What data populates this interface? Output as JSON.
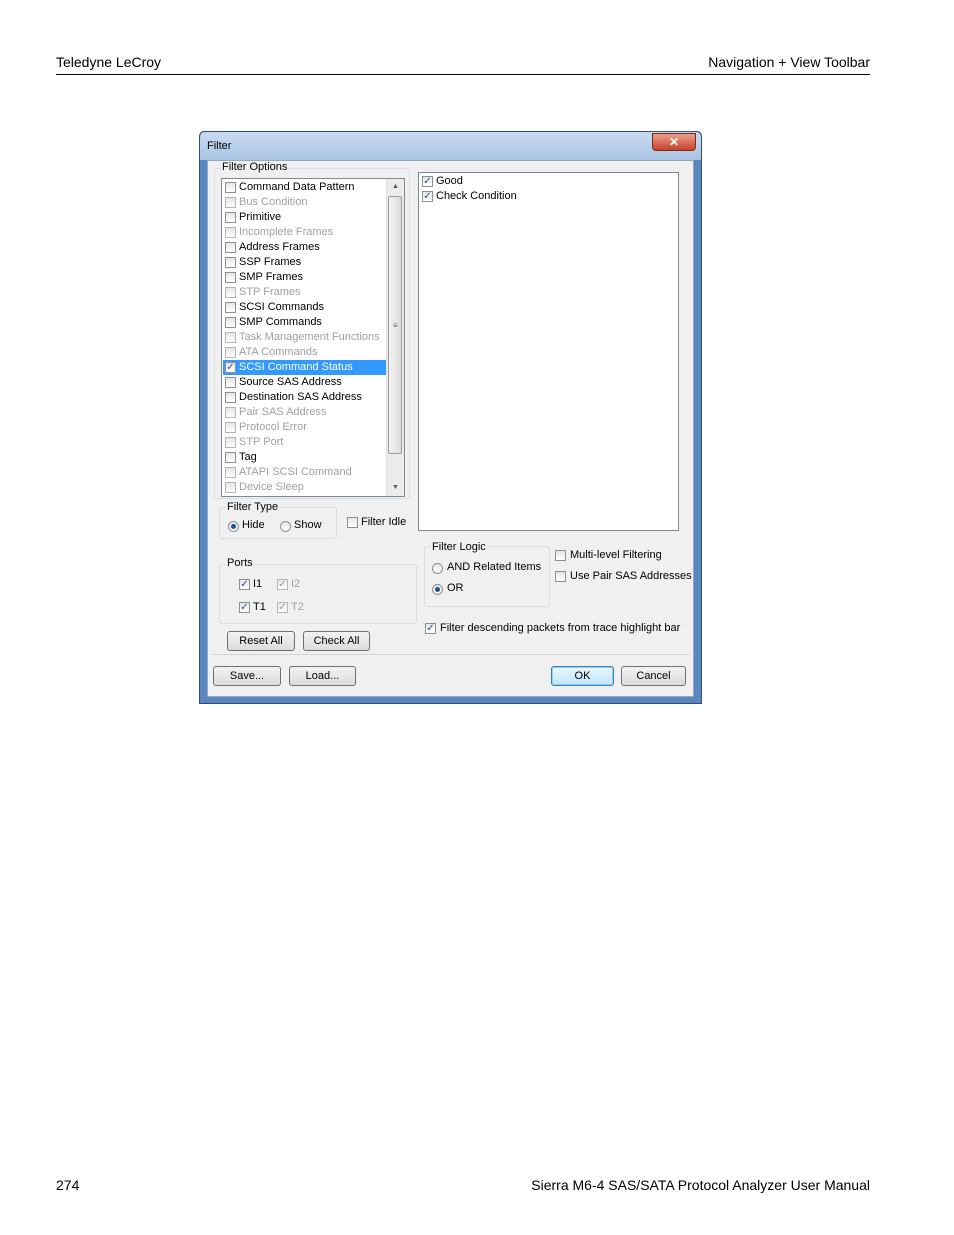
{
  "page": {
    "header_left": "Teledyne LeCroy",
    "header_right": "Navigation + View Toolbar",
    "footer_left": "274",
    "footer_right": "Sierra M6-4 SAS/SATA Protocol Analyzer User Manual"
  },
  "dialog": {
    "title": "Filter",
    "close_glyph": "✕",
    "filter_options": {
      "label": "Filter Options",
      "items": [
        {
          "label": "Command Data Pattern",
          "checked": false,
          "enabled": true,
          "selected": false
        },
        {
          "label": "Bus Condition",
          "checked": false,
          "enabled": false,
          "selected": false
        },
        {
          "label": "Primitive",
          "checked": false,
          "enabled": true,
          "selected": false
        },
        {
          "label": "Incomplete Frames",
          "checked": false,
          "enabled": false,
          "selected": false
        },
        {
          "label": "Address Frames",
          "checked": false,
          "enabled": true,
          "selected": false
        },
        {
          "label": "SSP Frames",
          "checked": false,
          "enabled": true,
          "selected": false
        },
        {
          "label": "SMP Frames",
          "checked": false,
          "enabled": true,
          "selected": false
        },
        {
          "label": "STP Frames",
          "checked": false,
          "enabled": false,
          "selected": false
        },
        {
          "label": "SCSI Commands",
          "checked": false,
          "enabled": true,
          "selected": false
        },
        {
          "label": "SMP Commands",
          "checked": false,
          "enabled": true,
          "selected": false
        },
        {
          "label": "Task Management Functions",
          "checked": false,
          "enabled": false,
          "selected": false
        },
        {
          "label": "ATA Commands",
          "checked": false,
          "enabled": false,
          "selected": false
        },
        {
          "label": "SCSI Command Status",
          "checked": true,
          "enabled": true,
          "selected": true
        },
        {
          "label": "Source SAS Address",
          "checked": false,
          "enabled": true,
          "selected": false
        },
        {
          "label": "Destination SAS Address",
          "checked": false,
          "enabled": true,
          "selected": false
        },
        {
          "label": "Pair SAS Address",
          "checked": false,
          "enabled": false,
          "selected": false
        },
        {
          "label": "Protocol Error",
          "checked": false,
          "enabled": false,
          "selected": false
        },
        {
          "label": "STP Port",
          "checked": false,
          "enabled": false,
          "selected": false
        },
        {
          "label": "Tag",
          "checked": false,
          "enabled": true,
          "selected": false
        },
        {
          "label": "ATAPI SCSI Command",
          "checked": false,
          "enabled": false,
          "selected": false
        },
        {
          "label": "Device Sleep",
          "checked": false,
          "enabled": false,
          "selected": false
        }
      ]
    },
    "status_values": [
      {
        "label": "Good",
        "checked": true
      },
      {
        "label": "Check Condition",
        "checked": true
      }
    ],
    "filter_type": {
      "label": "Filter Type",
      "hide_label": "Hide",
      "show_label": "Show",
      "selected": "Hide"
    },
    "filter_idle": {
      "label": "Filter Idle",
      "checked": false
    },
    "ports": {
      "label": "Ports",
      "items": [
        {
          "label": "I1",
          "checked": true,
          "enabled": true
        },
        {
          "label": "I2",
          "checked": true,
          "enabled": false
        },
        {
          "label": "T1",
          "checked": true,
          "enabled": true
        },
        {
          "label": "T2",
          "checked": true,
          "enabled": false
        }
      ]
    },
    "filter_logic": {
      "label": "Filter Logic",
      "and_label": "AND Related Items",
      "or_label": "OR",
      "selected": "OR"
    },
    "multi_level": {
      "label": "Multi-level Filtering",
      "checked": false
    },
    "use_pair_sas": {
      "label": "Use Pair SAS Addresses",
      "checked": false
    },
    "filter_descending": {
      "label": "Filter descending packets from trace highlight bar",
      "checked": true
    },
    "buttons": {
      "reset_all": "Reset All",
      "check_all": "Check All",
      "save": "Save...",
      "load": "Load...",
      "ok": "OK",
      "cancel": "Cancel"
    },
    "check_glyph": "✓",
    "scroll_up": "▲",
    "scroll_down": "▼",
    "scroll_grip": "≡"
  }
}
